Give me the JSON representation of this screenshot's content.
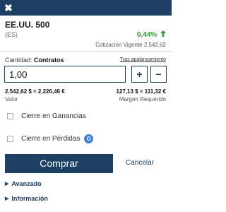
{
  "header": {
    "close_glyph": "✖"
  },
  "instrument": {
    "name": "EE.UU. 500",
    "sub": "(ES)",
    "change": "0,44%",
    "change_color": "#2e9b2e",
    "change_icon": "arrow-up-icon",
    "quote_label": "Cotización Vigente",
    "quote_value": "2.542,62"
  },
  "quantity": {
    "label": "Cantidad:",
    "unit": "Contratos",
    "leverage_link": "Tras apalancamiento",
    "value": "1,00",
    "plus": "+",
    "minus": "−"
  },
  "calc": {
    "value_line": "2.542,62 $ = 2.226,46 €",
    "value_label": "Valor",
    "margin_line": "127,13 $ = 111,32 €",
    "margin_label": "Margen Requerido"
  },
  "options": {
    "take_profit": "Cierre en Ganancias",
    "stop_loss": "Cierre en Pérdidas",
    "stop_loss_badge": "G"
  },
  "actions": {
    "buy": "Comprar",
    "cancel": "Cancelar"
  },
  "sections": {
    "advanced": "Avanzado",
    "info": "Información"
  },
  "colors": {
    "brand": "#1c3f63",
    "positive": "#2e9b2e",
    "badge": "#3d7fd6"
  }
}
